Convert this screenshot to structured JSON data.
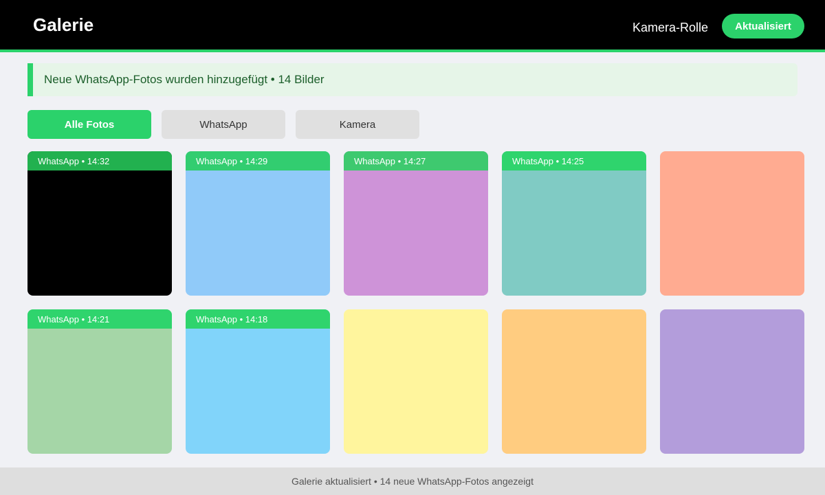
{
  "header": {
    "title": "Galerie",
    "album": "Kamera-Rolle",
    "refresh_label": "Aktualisiert"
  },
  "banner": {
    "text": "Neue WhatsApp-Fotos wurden hinzugefügt • 14 Bilder"
  },
  "tabs": [
    {
      "label": "Alle Fotos",
      "active": true
    },
    {
      "label": "WhatsApp",
      "active": false
    },
    {
      "label": "Kamera",
      "active": false
    }
  ],
  "photos": [
    {
      "color": "#000000",
      "tag": "WhatsApp • 14:32",
      "tag_color": "#22b14f"
    },
    {
      "color": "#90caf9",
      "tag": "WhatsApp • 14:29",
      "tag_color": "#32cd70"
    },
    {
      "color": "#ce93d8",
      "tag": "WhatsApp • 14:27",
      "tag_color": "#3ec96f"
    },
    {
      "color": "#80cbc4",
      "tag": "WhatsApp • 14:25",
      "tag_color": "#2fd46d"
    },
    {
      "color": "#ffab91",
      "tag": "",
      "tag_color": ""
    },
    {
      "color": "#a5d6a7",
      "tag": "WhatsApp • 14:21",
      "tag_color": "#2fd46d"
    },
    {
      "color": "#81d4fa",
      "tag": "WhatsApp • 14:18",
      "tag_color": "#2fd46d"
    },
    {
      "color": "#fff59d",
      "tag": "",
      "tag_color": ""
    },
    {
      "color": "#ffcc80",
      "tag": "",
      "tag_color": ""
    },
    {
      "color": "#b39ddb",
      "tag": "",
      "tag_color": ""
    }
  ],
  "status": {
    "text": "Galerie aktualisiert • 14 neue WhatsApp-Fotos angezeigt"
  },
  "colors": {
    "accent": "#2bd26b",
    "header_bg": "#000000",
    "page_bg": "#f0f1f5",
    "banner_bg": "#e6f5e8",
    "banner_text": "#1b5e2a"
  }
}
